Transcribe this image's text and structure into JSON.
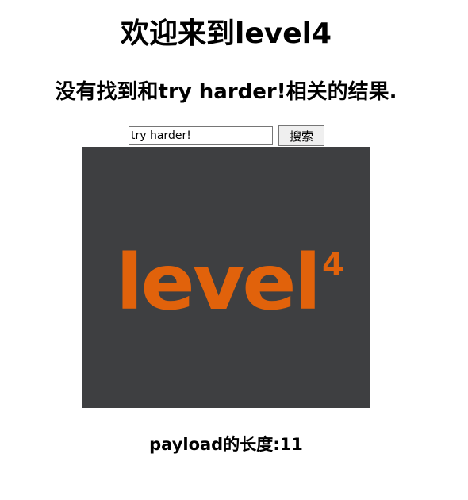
{
  "header": {
    "title": "欢迎来到level4",
    "result_message": "没有找到和try harder!相关的结果."
  },
  "search": {
    "value": "try harder!",
    "button_label": "搜索"
  },
  "logo": {
    "text": "level",
    "superscript": "4",
    "background_color": "#3e3f41",
    "text_color": "#e1620b"
  },
  "footer": {
    "payload_length": "payload的长度:11"
  }
}
